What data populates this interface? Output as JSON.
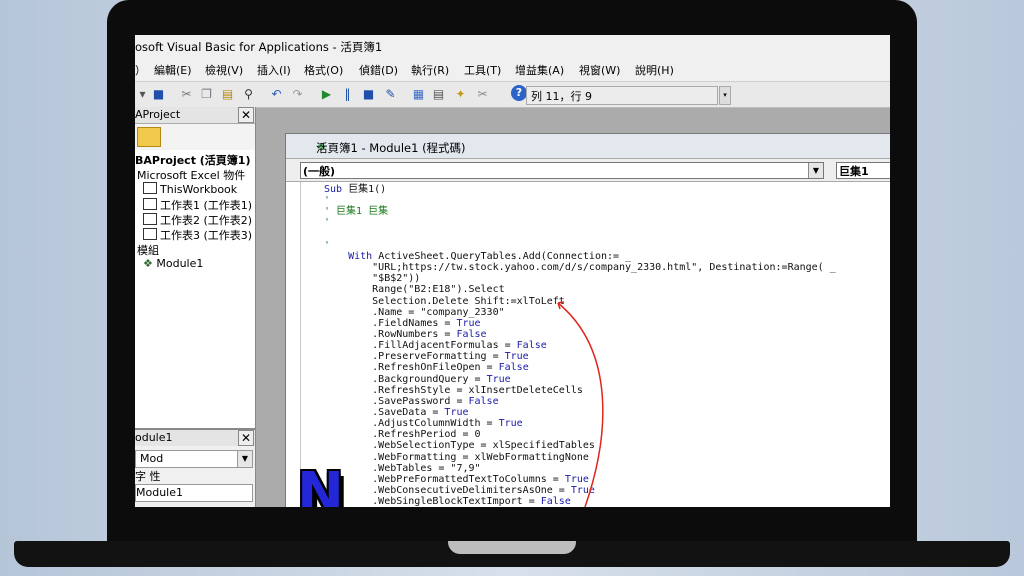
{
  "window": {
    "title": "osoft Visual Basic for Applications - 活頁簿1"
  },
  "menu": [
    "）",
    "編輯(E)",
    "檢視(V)",
    "插入(I)",
    "格式(O)",
    "偵錯(D)",
    "執行(R)",
    "工具(T)",
    "增益集(A)",
    "視窗(W)",
    "說明(H)"
  ],
  "toolbar": {
    "cursor_position": "列 11，行 9"
  },
  "project": {
    "title": "AProject",
    "tree": [
      "BAProject (活頁簿1)",
      "Microsoft Excel 物件",
      "ThisWorkbook",
      "工作表1 (工作表1)",
      "工作表2 (工作表2)",
      "工作表3 (工作表3)",
      "模組",
      "Module1"
    ]
  },
  "properties": {
    "title": "odule1",
    "combo": "Mod",
    "tabs": "字  性",
    "value": "Module1"
  },
  "logo": {
    "letter": "N"
  },
  "code_window": {
    "title": "活頁簿1 - Module1 (程式碼)",
    "object_combo": "(一般)",
    "proc_combo": "巨集1",
    "lines": [
      "Sub 巨集1()",
      "'",
      "' 巨集1 巨集",
      "'",
      "",
      "'",
      "    With ActiveSheet.QueryTables.Add(Connection:= _",
      "        \"URL;https://tw.stock.yahoo.com/d/s/company_2330.html\", Destination:=Range( _",
      "        \"$B$2\"))",
      "        Range(\"B2:E18\").Select",
      "        Selection.Delete Shift:=xlToLeft",
      "        .Name = \"company_2330\"",
      "        .FieldNames = True",
      "        .RowNumbers = False",
      "        .FillAdjacentFormulas = False",
      "        .PreserveFormatting = True",
      "        .RefreshOnFileOpen = False",
      "        .BackgroundQuery = True",
      "        .RefreshStyle = xlInsertDeleteCells",
      "        .SavePassword = False",
      "        .SaveData = True",
      "        .AdjustColumnWidth = True",
      "        .RefreshPeriod = 0",
      "        .WebSelectionType = xlSpecifiedTables",
      "        .WebFormatting = xlWebFormattingNone",
      "        .WebTables = \"7,9\"",
      "        .WebPreFormattedTextToColumns = True",
      "        .WebConsecutiveDelimitersAsOne = True",
      "        .WebSingleBlockTextImport = False"
    ]
  },
  "colors": {
    "keyword": "#1c1ca8",
    "comment": "#1a7a1a",
    "annotation": "#e0261b",
    "logo": "#2427d8"
  }
}
